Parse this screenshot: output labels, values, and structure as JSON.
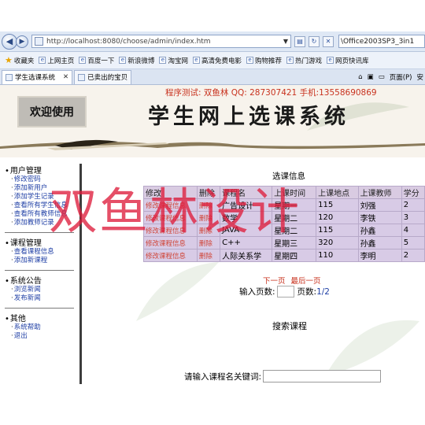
{
  "browser": {
    "address": "http://localhost:8080/choose/admin/index.htm",
    "right_field": "\\Office2003SP3_3in1",
    "favorites": [
      "收藏夹",
      "上网主页",
      "百度一下",
      "新浪微博",
      "淘宝网",
      "高清免费电影",
      "购物推荐",
      "热门游戏",
      "网页快讯库"
    ],
    "tabs": [
      "学生选课系统",
      "已卖出的宝贝"
    ],
    "tools": [
      "页面(P)",
      "安"
    ]
  },
  "header": {
    "contact": "程序测试: 双鱼林 QQ: 287307421 手机:13558690869",
    "welcome": "欢迎使用",
    "site_title": "学生网上选课系统"
  },
  "sidebar": {
    "groups": [
      {
        "title": "用户管理",
        "items": [
          "修改密码",
          "添加新用户",
          "添加学生记录",
          "查看所有学生信息",
          "查看所有教师信息",
          "添加教师记录"
        ]
      },
      {
        "title": "课程管理",
        "items": [
          "查看课程信息",
          "添加新课程"
        ]
      },
      {
        "title": "系统公告",
        "items": [
          "浏览新闻",
          "发布新闻"
        ]
      },
      {
        "title": "其他",
        "items": [
          "系统帮助",
          "退出"
        ]
      }
    ]
  },
  "main": {
    "section_title": "选课信息",
    "table": {
      "headers": [
        "修改",
        "删除",
        "课程名",
        "上课时间",
        "上课地点",
        "上课教师",
        "学分"
      ],
      "rows": [
        [
          "修改课程信息",
          "删除",
          "广告设计",
          "星期一",
          "115",
          "刘强",
          "2"
        ],
        [
          "修改课程信息",
          "删除",
          "数学",
          "星期二",
          "120",
          "李铁",
          "3"
        ],
        [
          "修改课程信息",
          "删除",
          "JAVA",
          "星期二",
          "115",
          "孙鑫",
          "4"
        ],
        [
          "修改课程信息",
          "删除",
          "C++",
          "星期三",
          "320",
          "孙鑫",
          "5"
        ],
        [
          "修改课程信息",
          "删除",
          "人际关系学",
          "星期四",
          "110",
          "李明",
          "2"
        ]
      ]
    },
    "pager": {
      "next": "下一页",
      "last": "最后一页"
    },
    "page_input_label": "输入页数:",
    "page_count_label": "页数:",
    "page_count": "1/2",
    "search_title": "搜索课程",
    "search_label": "请输入课程名关键词:"
  },
  "watermark": "双鱼林设计"
}
